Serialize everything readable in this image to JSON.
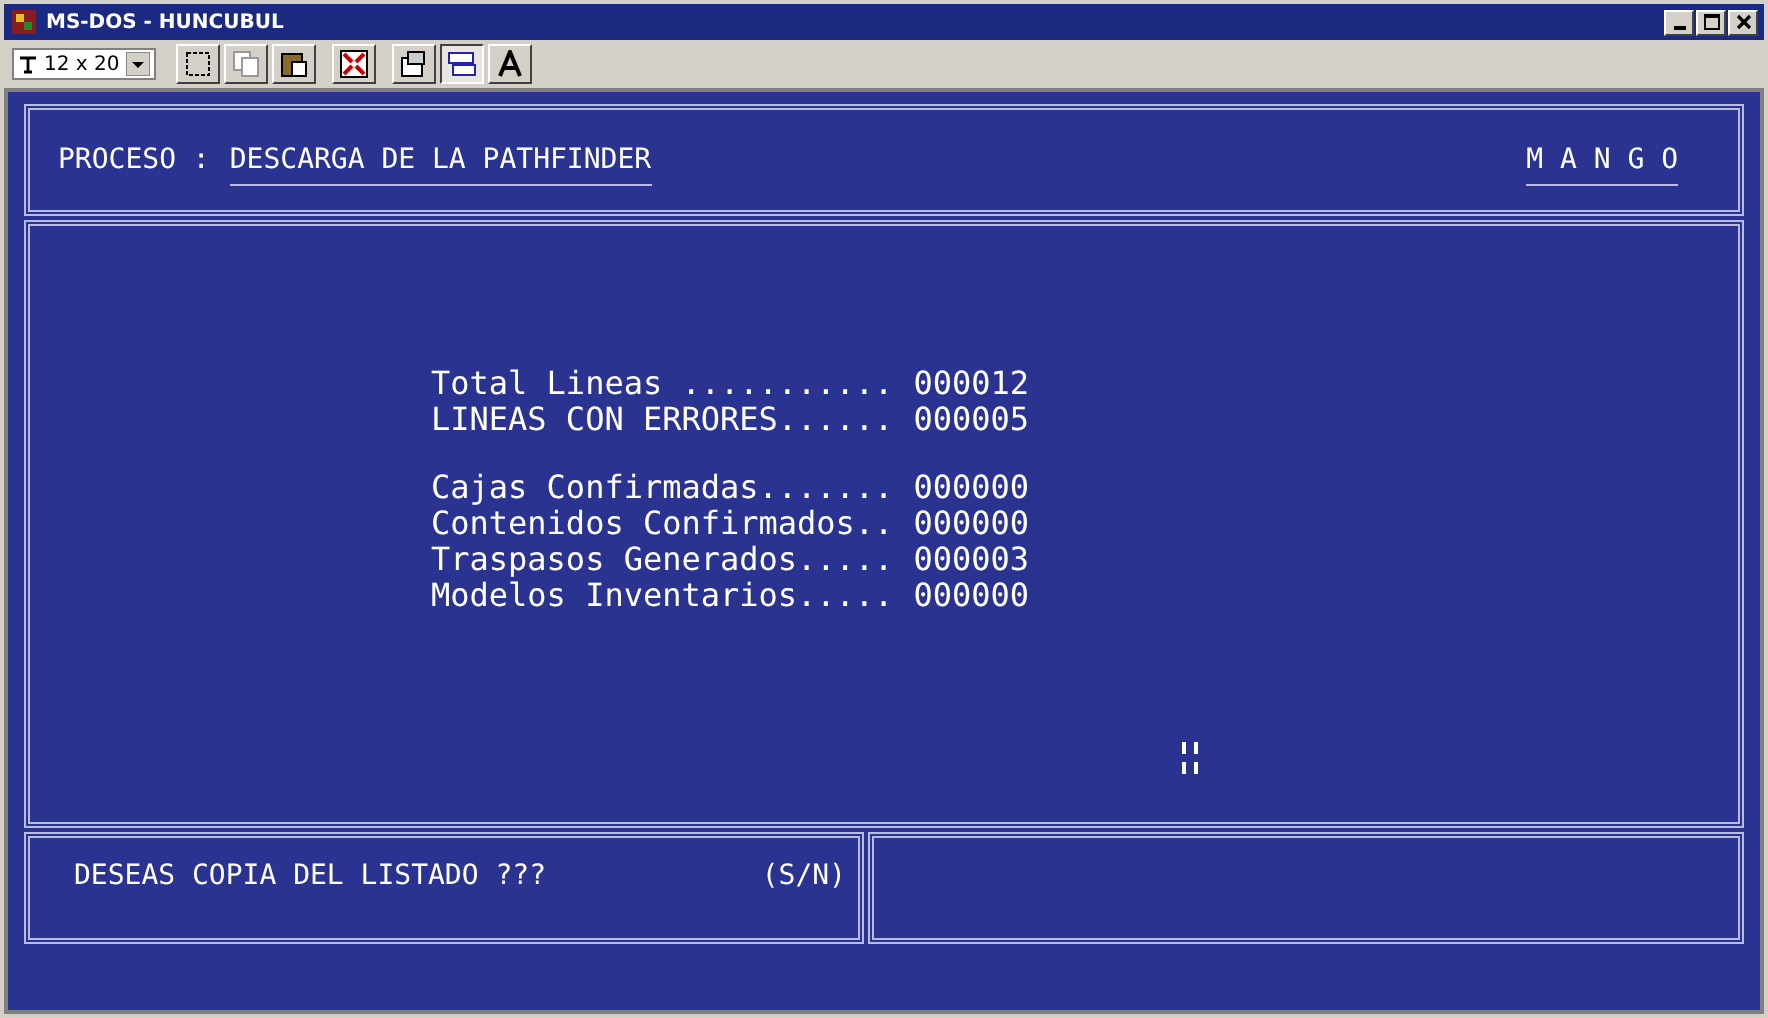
{
  "window": {
    "title": "MS-DOS - HUNCUBUL"
  },
  "toolbar": {
    "font_size": "12 x 20"
  },
  "header": {
    "process_label": "PROCESO :",
    "process_name": "DESCARGA DE LA PATHFINDER",
    "brand": "M A N G O"
  },
  "stat_groups": [
    [
      {
        "label": "Total Lineas ...........",
        "value": "000012"
      },
      {
        "label": "LINEAS CON ERRORES......",
        "value": "000005"
      }
    ],
    [
      {
        "label": "Cajas Confirmadas.......",
        "value": "000000"
      },
      {
        "label": "Contenidos Confirmados..",
        "value": "000000"
      },
      {
        "label": "Traspasos Generados.....",
        "value": "000003"
      },
      {
        "label": "Modelos Inventarios.....",
        "value": "000000"
      }
    ]
  ],
  "prompt": {
    "question": "DESEAS COPIA DEL LISTADO ???",
    "options": "(S/N)"
  }
}
